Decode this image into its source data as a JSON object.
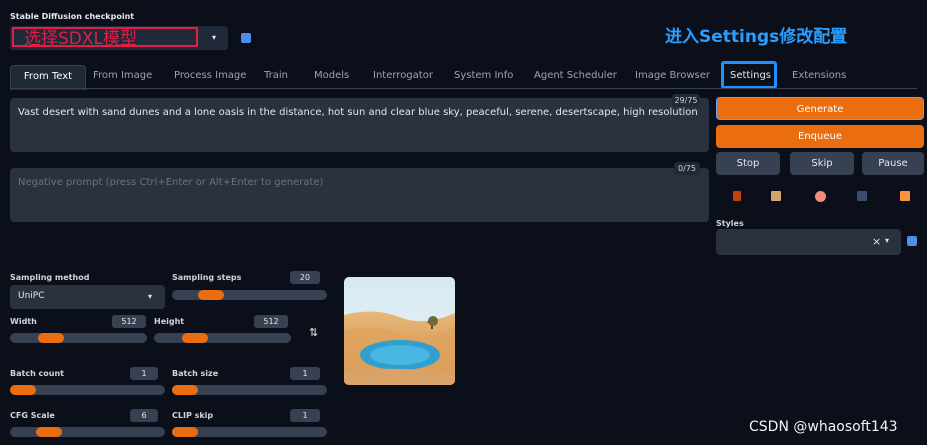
{
  "checkpoint": {
    "label": "Stable Diffusion checkpoint",
    "value": "选择SDXL模型",
    "refresh_icon": "refresh-icon"
  },
  "annotation": {
    "settings_note": "进入Settings修改配置"
  },
  "tabs": [
    {
      "label": "From Text",
      "active": true
    },
    {
      "label": "From Image"
    },
    {
      "label": "Process Image"
    },
    {
      "label": "Train"
    },
    {
      "label": "Models"
    },
    {
      "label": "Interrogator"
    },
    {
      "label": "System Info"
    },
    {
      "label": "Agent Scheduler"
    },
    {
      "label": "Image Browser"
    },
    {
      "label": "Settings",
      "highlighted": true
    },
    {
      "label": "Extensions"
    }
  ],
  "prompt": {
    "text": "Vast desert with sand dunes and a lone oasis in the distance, hot sun and clear blue sky, peaceful, serene, desertscape, high resolution",
    "counter": "29/75"
  },
  "negative_prompt": {
    "placeholder": "Negative prompt (press Ctrl+Enter or Alt+Enter to generate)",
    "counter": "0/75"
  },
  "actions": {
    "generate": "Generate",
    "enqueue": "Enqueue",
    "stop": "Stop",
    "skip": "Skip",
    "pause": "Pause"
  },
  "styles": {
    "label": "Styles",
    "clear": "×",
    "caret": "▾"
  },
  "params": {
    "sampling_method": {
      "label": "Sampling method",
      "value": "UniPC"
    },
    "sampling_steps": {
      "label": "Sampling steps",
      "value": "20",
      "fraction": 0.2
    },
    "width": {
      "label": "Width",
      "value": "512",
      "fraction": 0.25
    },
    "height": {
      "label": "Height",
      "value": "512",
      "fraction": 0.25
    },
    "swap_icon": "⇅",
    "batch_count": {
      "label": "Batch count",
      "value": "1",
      "fraction": 0.0
    },
    "batch_size": {
      "label": "Batch size",
      "value": "1",
      "fraction": 0.0
    },
    "cfg_scale": {
      "label": "CFG Scale",
      "value": "6",
      "fraction": 0.2
    },
    "clip_skip": {
      "label": "CLIP skip",
      "value": "1",
      "fraction": 0.0
    }
  },
  "watermark": "CSDN @whaosoft143",
  "colors": {
    "accent": "#ea6d10",
    "highlight_box": "#1e90ff",
    "annotation_red": "#e11d48"
  }
}
